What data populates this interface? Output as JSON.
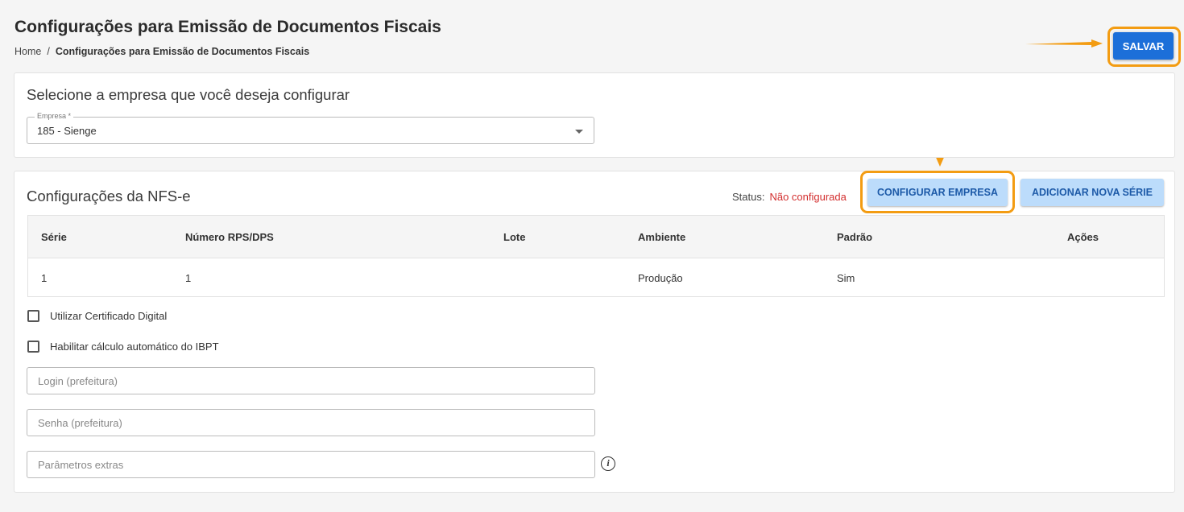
{
  "header": {
    "title": "Configurações para Emissão de Documentos Fiscais",
    "breadcrumb": {
      "home": "Home",
      "separator": "/",
      "current": "Configurações para Emissão de Documentos Fiscais"
    },
    "save_label": "SALVAR"
  },
  "company_card": {
    "title": "Selecione a empresa que você deseja configurar",
    "select_label": "Empresa *",
    "select_value": "185 - Sienge"
  },
  "nfse_card": {
    "title": "Configurações da NFS-e",
    "status_label": "Status:",
    "status_value": "Não configurada",
    "configure_label": "CONFIGURAR EMPRESA",
    "add_series_label": "ADICIONAR NOVA SÉRIE",
    "table": {
      "headers": [
        "Série",
        "Número RPS/DPS",
        "Lote",
        "Ambiente",
        "Padrão",
        "Ações"
      ],
      "rows": [
        {
          "serie": "1",
          "numero": "1",
          "lote": "",
          "ambiente": "Produção",
          "padrao": "Sim",
          "acoes": ""
        }
      ]
    },
    "checkbox_certificate": "Utilizar Certificado Digital",
    "checkbox_ibpt": "Habilitar cálculo automático do IBPT",
    "login_placeholder": "Login (prefeitura)",
    "password_placeholder": "Senha (prefeitura)",
    "extra_params_placeholder": "Parâmetros extras",
    "info_icon": "i"
  },
  "colors": {
    "primary": "#1c6fd9",
    "light_button": "#bcdcfb",
    "status_error": "#d32f2f",
    "highlight": "#f39c12"
  },
  "icons": {
    "dropdown": "chevron-down-icon",
    "info": "info-icon",
    "annotation_arrow": "arrow-icon"
  }
}
